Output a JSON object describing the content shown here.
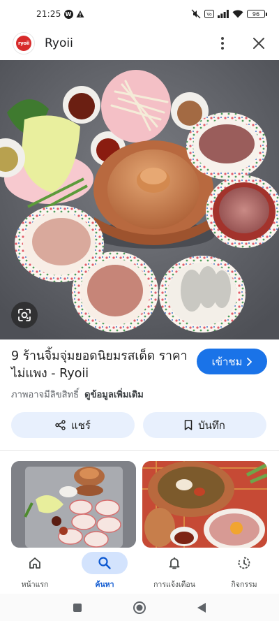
{
  "status_bar": {
    "time": "21:25",
    "battery": "96"
  },
  "header": {
    "site_name": "Ryoii",
    "logo_text": "ryoii"
  },
  "result": {
    "title": "9 ร้านจิ้มจุ่มยอดนิยมรสเด็ด ราคาไม่แพง - Ryoii",
    "visit_label": "เข้าชม",
    "copyright_notice": "ภาพอาจมีลิขสิทธิ์",
    "more_info_link": "ดูข้อมูลเพิ่มเติม",
    "share_label": "แชร์",
    "save_label": "บันทึก"
  },
  "bottom_nav": {
    "items": [
      {
        "label": "หน้าแรก",
        "icon": "home-icon",
        "active": false
      },
      {
        "label": "ค้นหา",
        "icon": "search-icon",
        "active": true
      },
      {
        "label": "การแจ้งเตือน",
        "icon": "bell-icon",
        "active": false
      },
      {
        "label": "กิจกรรม",
        "icon": "activity-icon",
        "active": false
      }
    ]
  },
  "colors": {
    "accent": "#1a73e8",
    "pill_bg": "#e8f0fd",
    "nav_active_bg": "#d3e3fd",
    "nav_active_text": "#0b57d0"
  }
}
